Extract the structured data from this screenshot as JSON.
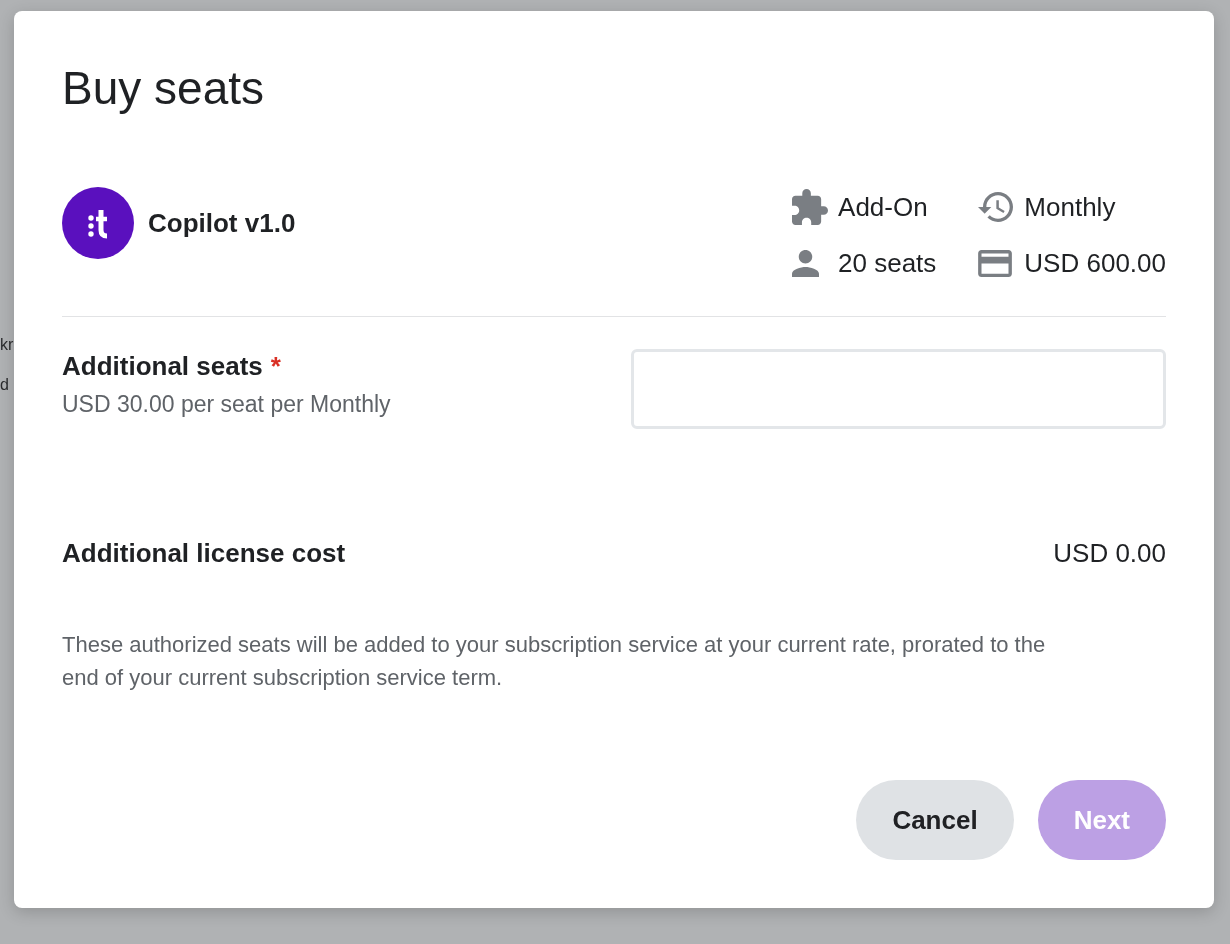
{
  "backdrop": {
    "text_fragments": [
      "kr",
      "d"
    ]
  },
  "dialog": {
    "title": "Buy seats",
    "product": {
      "name": "Copilot v1.0"
    },
    "meta": [
      {
        "kind": "type",
        "text": "Add-On"
      },
      {
        "kind": "billing",
        "text": "Monthly"
      },
      {
        "kind": "seats",
        "text": "20 seats"
      },
      {
        "kind": "price",
        "text": "USD 600.00"
      }
    ],
    "field": {
      "label": "Additional seats",
      "required": true,
      "required_mark": "*",
      "hint": "USD 30.00 per seat per Monthly"
    },
    "cost": {
      "label": "Additional license cost",
      "value": "USD 0.00"
    },
    "note": "These authorized seats will be added to your subscription service at your current rate, prorated to the end of your current subscription service term.",
    "buttons": [
      {
        "kind": "secondary",
        "label": "Cancel",
        "disabled": false
      },
      {
        "kind": "primary",
        "label": "Next",
        "disabled": true
      }
    ]
  }
}
